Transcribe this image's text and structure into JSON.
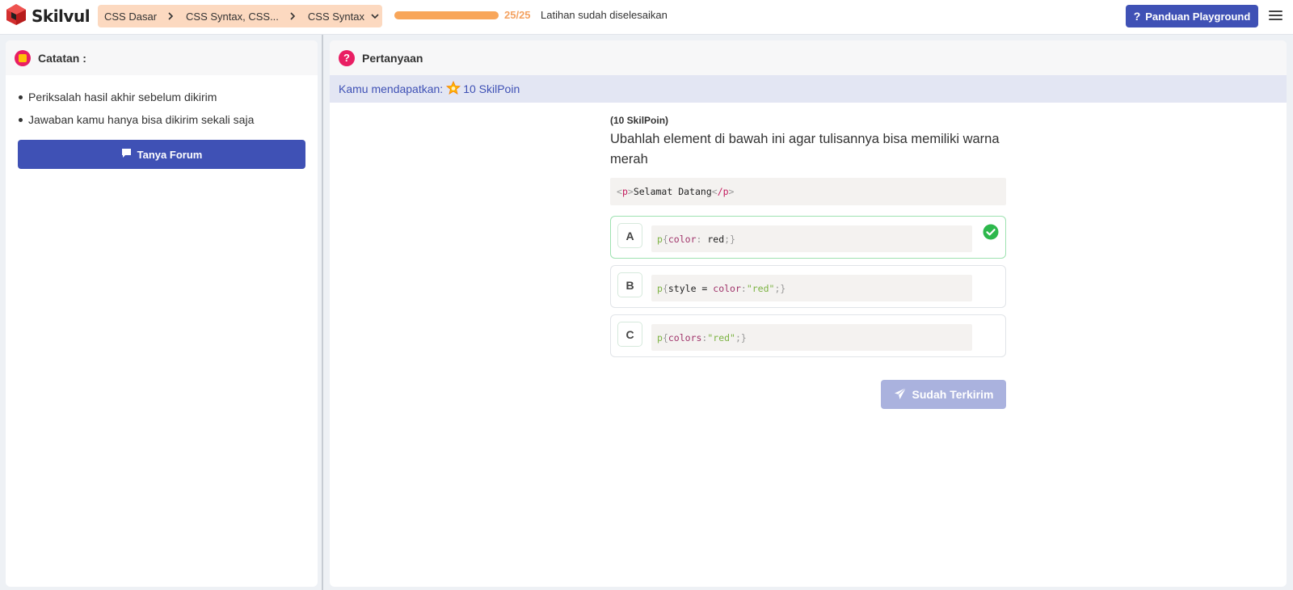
{
  "header": {
    "brand": "Skilvul",
    "breadcrumb": [
      "CSS Dasar",
      "CSS Syntax, CSS...",
      "CSS Syntax"
    ],
    "progress": {
      "count": "25/25",
      "label": "Latihan sudah diselesaikan",
      "fraction": 1.0
    },
    "guide_button": "Panduan Playground",
    "icons": {
      "logo": "skilvul-cube-logo",
      "dropdown": "chevron-down-icon",
      "menu": "hamburger-menu-icon",
      "help": "question-mark-icon"
    }
  },
  "notes_panel": {
    "title": "Catatan :",
    "items": [
      "Periksalah hasil akhir sebelum dikirim",
      "Jawaban kamu hanya bisa dikirim sekali saja"
    ],
    "forum_button": "Tanya Forum",
    "icons": {
      "header": "sticky-note-icon",
      "forum": "chat-bubble-icon"
    }
  },
  "question_panel": {
    "title": "Pertanyaan",
    "reward_prefix": "Kamu mendapatkan:",
    "reward_value": "10 SkilPoin",
    "points_label": "(10 SkilPoin)",
    "question": "Ubahlah element di bawah ini agar tulisannya bisa memiliki warna merah",
    "code": {
      "open_tag": "p",
      "content": "Selamat Datang",
      "close_tag": "/p"
    },
    "options": [
      {
        "letter": "A",
        "code": "p{color: red;}",
        "correct": true
      },
      {
        "letter": "B",
        "code": "p{style = color: \"red\";}",
        "correct": false
      },
      {
        "letter": "C",
        "code": "p{colors: \"red\";}",
        "correct": false
      }
    ],
    "submit_button": "Sudah Terkirim",
    "colors": {
      "accent": "#3f51b5",
      "correct": "#2db84c",
      "badge": "#e91e63",
      "progress": "#f8a65a"
    }
  }
}
